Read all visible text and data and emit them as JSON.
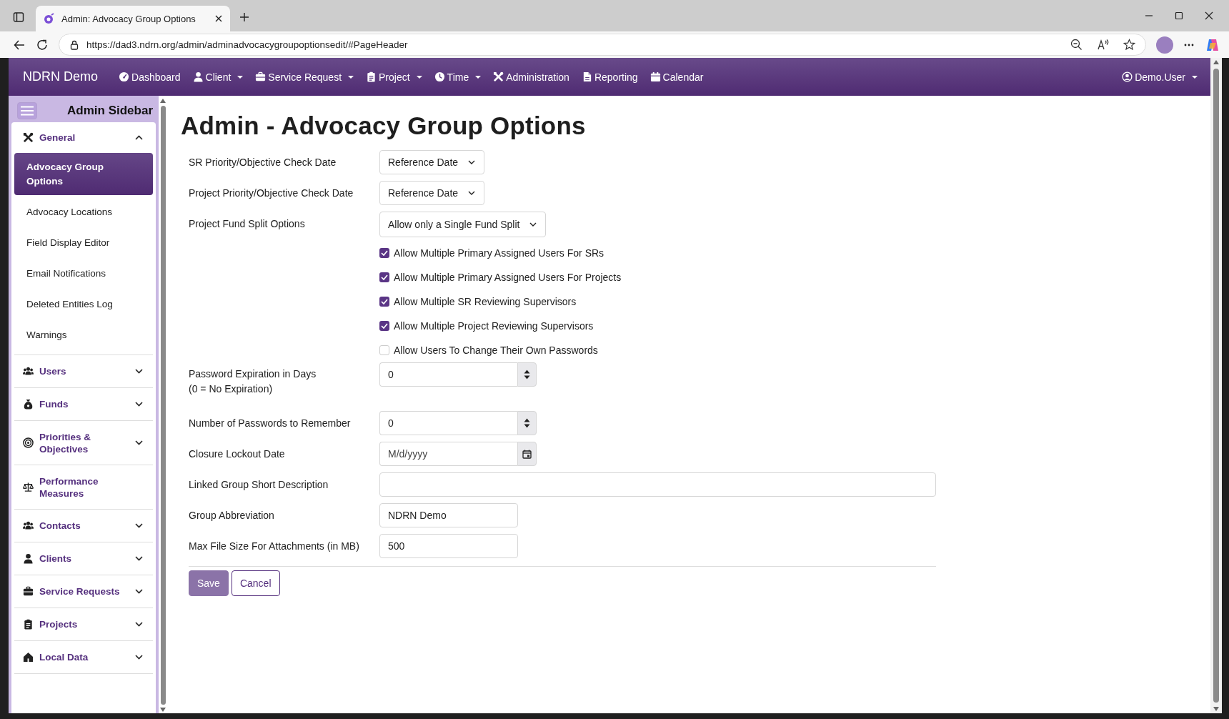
{
  "browser": {
    "tab_title": "Admin: Advocacy Group Options",
    "url": "https://dad3.ndrn.org/admin/adminadvocacygroupoptionsedit/#PageHeader"
  },
  "navbar": {
    "brand": "NDRN Demo",
    "items": [
      {
        "label": "Dashboard",
        "dropdown": false
      },
      {
        "label": "Client",
        "dropdown": true
      },
      {
        "label": "Service Request",
        "dropdown": true
      },
      {
        "label": "Project",
        "dropdown": true
      },
      {
        "label": "Time",
        "dropdown": true
      },
      {
        "label": "Administration",
        "dropdown": false
      },
      {
        "label": "Reporting",
        "dropdown": false
      },
      {
        "label": "Calendar",
        "dropdown": false
      }
    ],
    "user": {
      "label": "Demo.User",
      "dropdown": true
    }
  },
  "sidebar": {
    "title": "Admin Sidebar",
    "sections": [
      {
        "label": "General",
        "kind": "group",
        "expanded": true,
        "children": [
          {
            "label": "Advocacy Group Options",
            "selected": true
          },
          {
            "label": "Advocacy Locations",
            "selected": false
          },
          {
            "label": "Field Display Editor",
            "selected": false
          },
          {
            "label": "Email Notifications",
            "selected": false
          },
          {
            "label": "Deleted Entities Log",
            "selected": false
          },
          {
            "label": "Warnings",
            "selected": false
          }
        ]
      },
      {
        "label": "Users",
        "kind": "group",
        "expanded": false
      },
      {
        "label": "Funds",
        "kind": "group",
        "expanded": false
      },
      {
        "label": "Priorities & Objectives",
        "kind": "group",
        "expanded": false
      },
      {
        "label": "Performance Measures",
        "kind": "link"
      },
      {
        "label": "Contacts",
        "kind": "group",
        "expanded": false
      },
      {
        "label": "Clients",
        "kind": "group",
        "expanded": false
      },
      {
        "label": "Service Requests",
        "kind": "group",
        "expanded": false
      },
      {
        "label": "Projects",
        "kind": "group",
        "expanded": false
      },
      {
        "label": "Local Data",
        "kind": "group",
        "expanded": false
      }
    ]
  },
  "page": {
    "title": "Admin - Advocacy Group Options",
    "fields": [
      {
        "kind": "select",
        "label": "SR Priority/Objective Check Date",
        "value": "Reference Date"
      },
      {
        "kind": "select",
        "label": "Project Priority/Objective Check Date",
        "value": "Reference Date"
      },
      {
        "kind": "select",
        "label": "Project Fund Split Options",
        "value": "Allow only a Single Fund Split"
      },
      {
        "kind": "checkbox",
        "label": "Allow Multiple Primary Assigned Users For SRs",
        "checked": true
      },
      {
        "kind": "checkbox",
        "label": "Allow Multiple Primary Assigned Users For Projects",
        "checked": true
      },
      {
        "kind": "checkbox",
        "label": "Allow Multiple SR Reviewing Supervisors",
        "checked": true
      },
      {
        "kind": "checkbox",
        "label": "Allow Multiple Project Reviewing Supervisors",
        "checked": true
      },
      {
        "kind": "checkbox",
        "label": "Allow Users To Change Their Own Passwords",
        "checked": false
      },
      {
        "kind": "number",
        "label": "Password Expiration in Days",
        "note": "(0 = No Expiration)",
        "value": "0"
      },
      {
        "kind": "number",
        "label": "Number of Passwords to Remember",
        "value": "0"
      },
      {
        "kind": "date",
        "label": "Closure Lockout Date",
        "placeholder": "M/d/yyyy"
      },
      {
        "kind": "longtext",
        "label": "Linked Group Short Description"
      },
      {
        "kind": "text",
        "label": "Group Abbreviation",
        "value": "NDRN Demo"
      },
      {
        "kind": "text",
        "label": "Max File Size For Attachments (in MB)",
        "value": "500"
      }
    ],
    "buttons": [
      {
        "label": "Save",
        "kind": "primary"
      },
      {
        "label": "Cancel",
        "kind": "secondary"
      }
    ]
  }
}
